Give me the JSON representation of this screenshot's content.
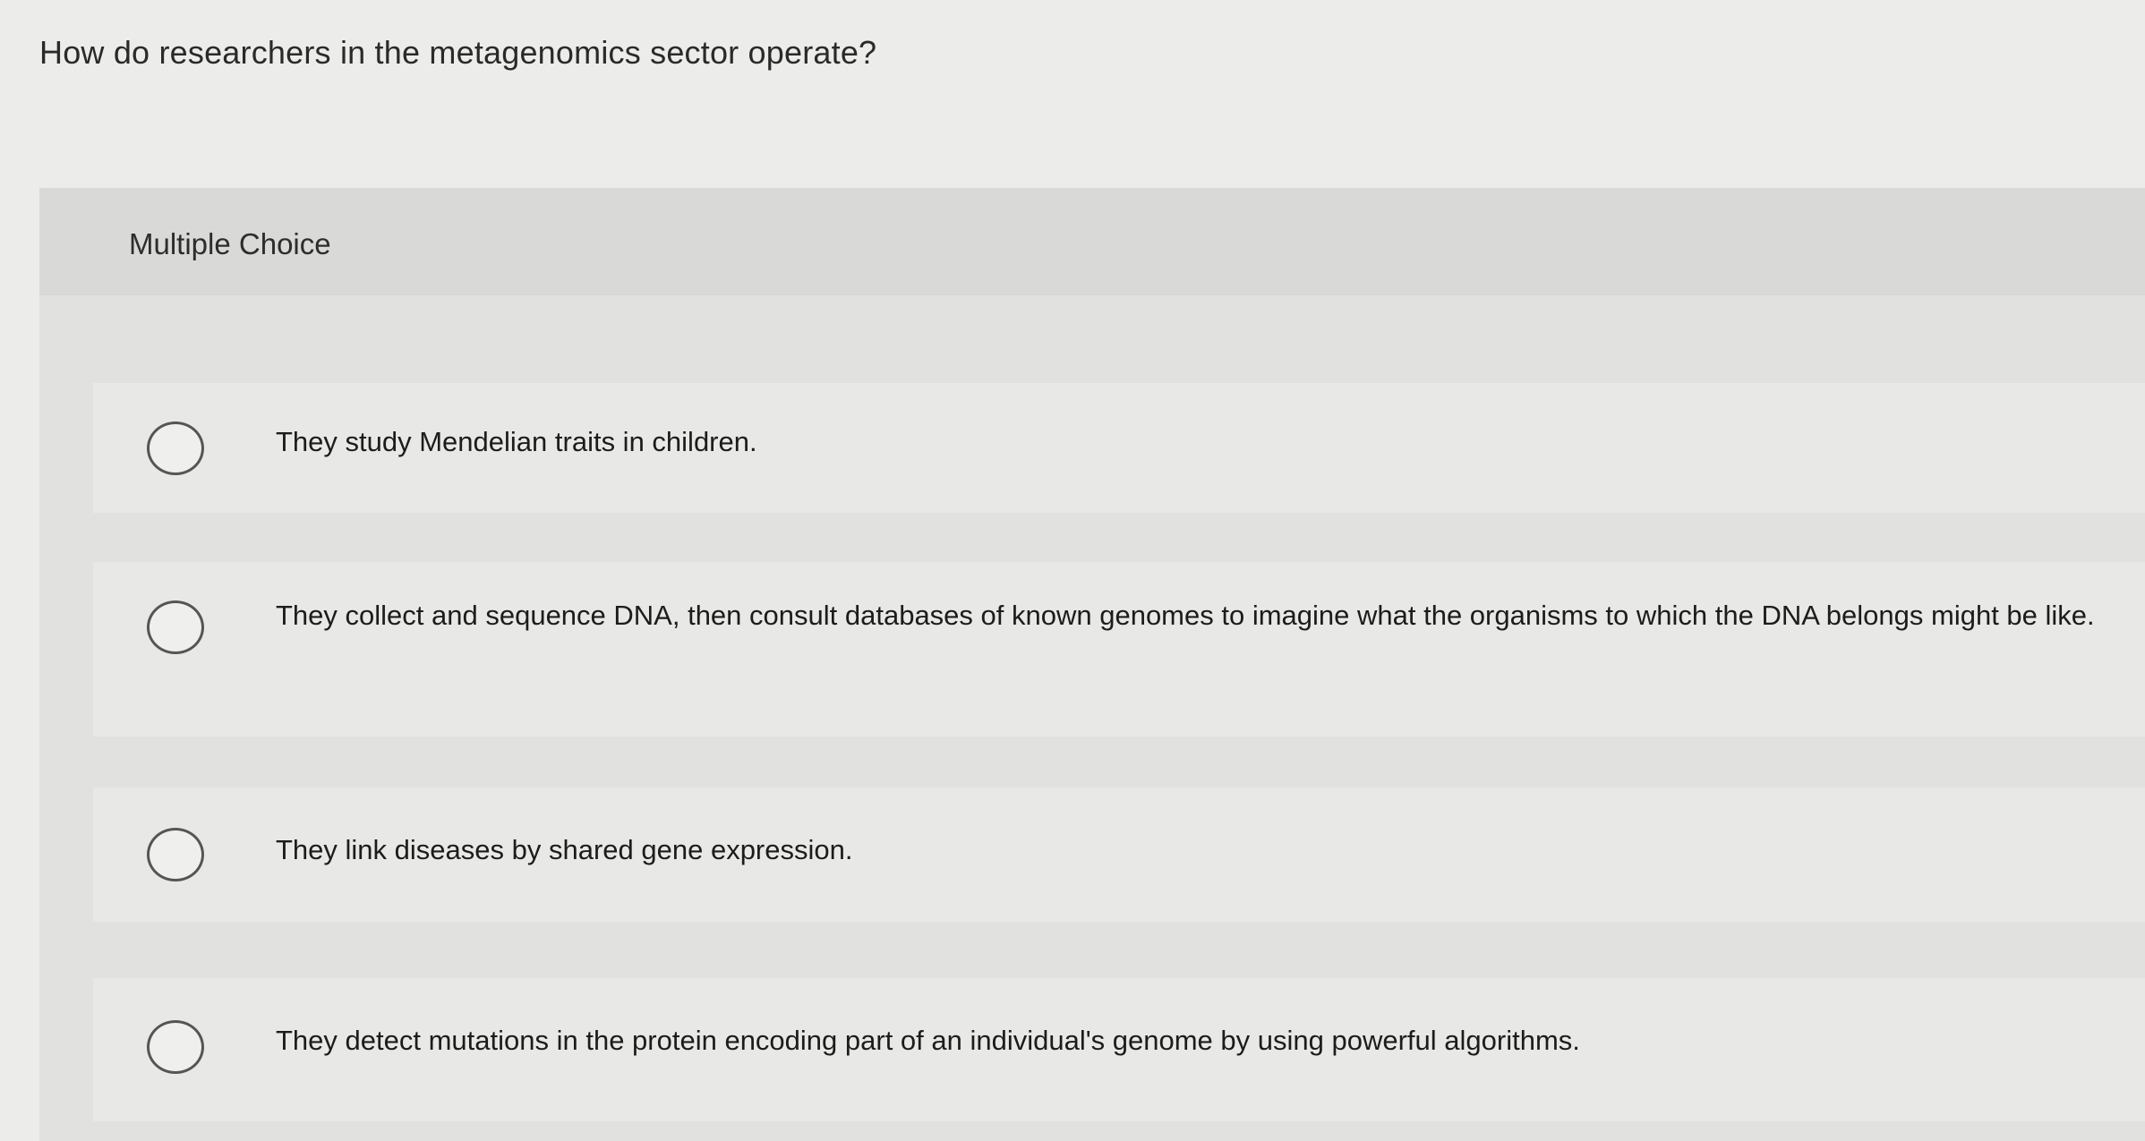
{
  "question": {
    "text": "How do researchers in the metagenomics sector operate?"
  },
  "panel": {
    "type_label": "Multiple Choice"
  },
  "options": [
    {
      "text": "They study Mendelian traits in children.",
      "selected": false
    },
    {
      "text": "They collect and sequence DNA, then consult databases of known genomes to imagine what the organisms to which the DNA belongs might be like.",
      "selected": false
    },
    {
      "text": "They link diseases by shared gene expression.",
      "selected": false
    },
    {
      "text": "They detect mutations in the protein encoding part of an individual's genome by using powerful algorithms.",
      "selected": false
    }
  ]
}
